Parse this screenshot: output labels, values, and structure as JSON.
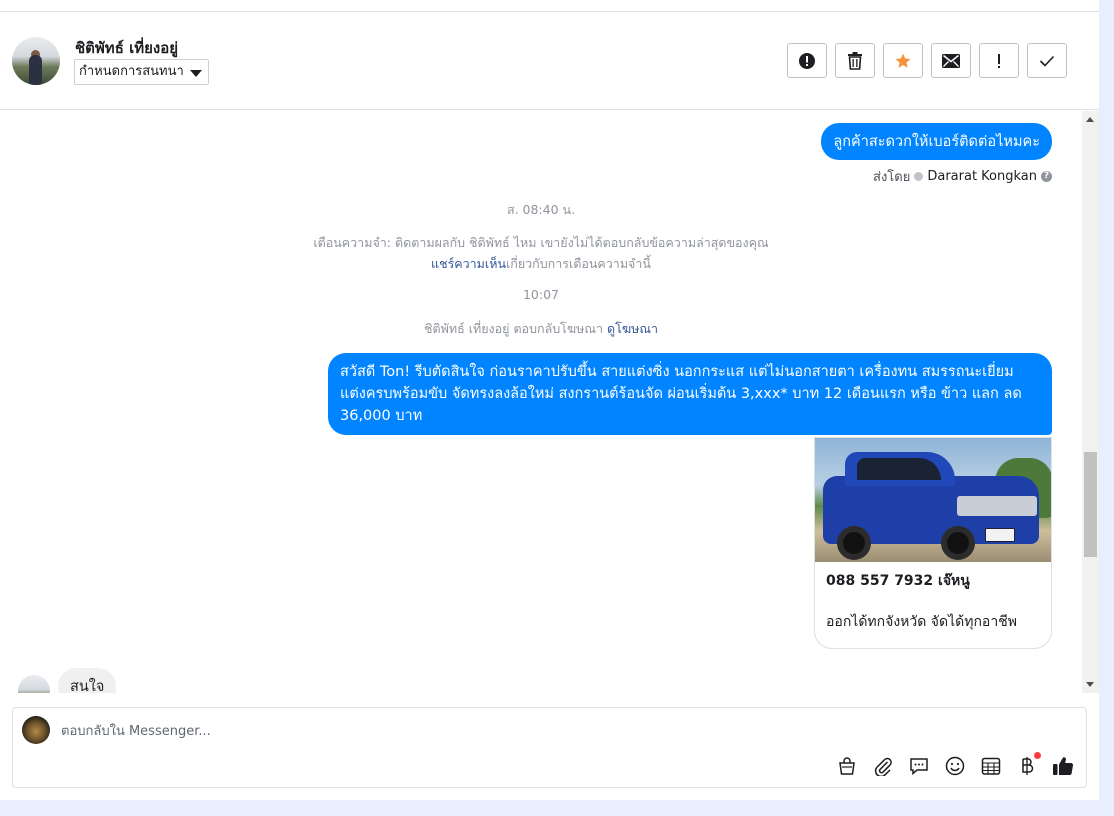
{
  "header": {
    "user_name": "ชิติพัทธ์ เที่ยงอยู่",
    "assign_label": "กำหนดการสนทนา",
    "actions": [
      "alert-circle-icon",
      "trash-icon",
      "star-icon",
      "envelope-icon",
      "exclamation-icon",
      "check-icon"
    ]
  },
  "thread": {
    "msg1": "ลูกค้าสะดวกให้เบอร์ติดต่อไหมคะ",
    "sent_by_label": "ส่งโดย",
    "sent_by_name": "Dararat Kongkan",
    "time1": "ส. 08:40 น.",
    "reminder_line1": "เตือนความจำ: ติดตามผลกับ ชิติพัทธ์ ไหม เขายังไม่ได้ตอบกลับข้อความล่าสุดของคุณ",
    "reminder_link": "แชร์ความเห็น",
    "reminder_line2": "เกี่ยวกับการเตือนความจำนี้",
    "time2": "10:07",
    "ad_reply_text": "ชิติพัทธ์ เที่ยงอยู่ ตอบกลับโฆษณา",
    "ad_reply_link": "ดูโฆษณา",
    "msg2": "สวัสดี Ton! รีบตัดสินใจ ก่อนราคาปรับขึ้น สายแต่งซิ่ง นอกกระแส แต่ไม่นอกสายตา เครื่องทน สมรรถนะเยี่ยม แต่งครบพร้อมขับ จัดทรงลงล้อใหม่ สงกรานต์ร้อนจัด ผ่อนเริ่มต้น 3,xxx* บาท 12 เดือนแรก หรือ ข้าว แลก ลด 36,000 บาท",
    "card_title": "088 557 7932 เจ๊หนู",
    "card_subtitle": "ออกได้ทกจังหวัด จัดได้ทุกอาชีพ",
    "incoming_msg": "สนใจ"
  },
  "composer": {
    "placeholder": "ตอบกลับใน Messenger...",
    "tools": [
      "shopping-bag-icon",
      "paperclip-icon",
      "saved-reply-icon",
      "emoji-icon",
      "calendar-icon",
      "baht-icon",
      "thumbs-up-icon"
    ]
  },
  "colors": {
    "accent": "#0084ff",
    "link": "#365899",
    "star": "#f7923b"
  }
}
